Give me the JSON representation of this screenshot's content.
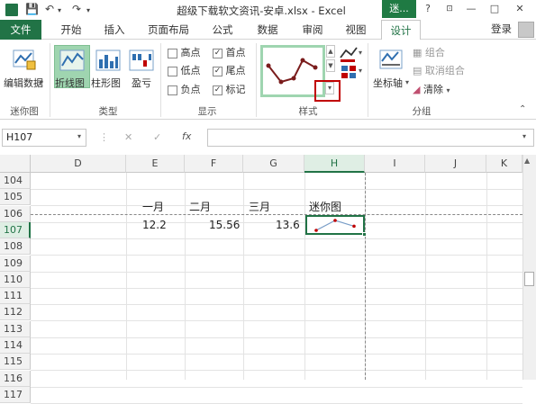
{
  "titlebar": {
    "title": "超级下载软文资讯-安卓.xlsx - Excel",
    "context_tab": "迷...",
    "help": "?",
    "minimize": "—",
    "restore": "□",
    "close": "✕"
  },
  "tabs": {
    "file": "文件",
    "items": [
      "开始",
      "插入",
      "页面布局",
      "公式",
      "数据",
      "审阅",
      "视图"
    ],
    "design": "设计",
    "login": "登录"
  },
  "ribbon": {
    "sparkline": {
      "edit_data": "编辑数据",
      "group": "迷你图"
    },
    "type": {
      "line": "折线图",
      "column": "柱形图",
      "winloss": "盈亏",
      "group": "类型"
    },
    "show": {
      "high": "高点",
      "first": "首点",
      "low": "低点",
      "last": "尾点",
      "negative": "负点",
      "markers": "标记",
      "group": "显示"
    },
    "style": {
      "group": "样式"
    },
    "grouping": {
      "axis": "坐标轴",
      "group_btn": "组合",
      "ungroup": "取消组合",
      "clear": "清除",
      "group": "分组"
    }
  },
  "formula": {
    "namebox": "H107",
    "cancel": "✕",
    "enter": "✓",
    "fx": "fx",
    "value": ""
  },
  "grid": {
    "columns": [
      "D",
      "E",
      "F",
      "G",
      "H",
      "I",
      "J",
      "K"
    ],
    "rows": [
      "104",
      "105",
      "106",
      "107",
      "108",
      "109",
      "110",
      "111",
      "112",
      "113",
      "114",
      "115",
      "116",
      "117"
    ],
    "row106": {
      "E": "一月",
      "F": "二月",
      "G": "三月",
      "H": "迷你图"
    },
    "row107": {
      "E": "12.2",
      "F": "15.56",
      "G": "13.6"
    },
    "sparkline_values": [
      12.2,
      15.56,
      13.6
    ]
  },
  "colors": {
    "accent": "#217346",
    "highlight": "#c00000"
  }
}
